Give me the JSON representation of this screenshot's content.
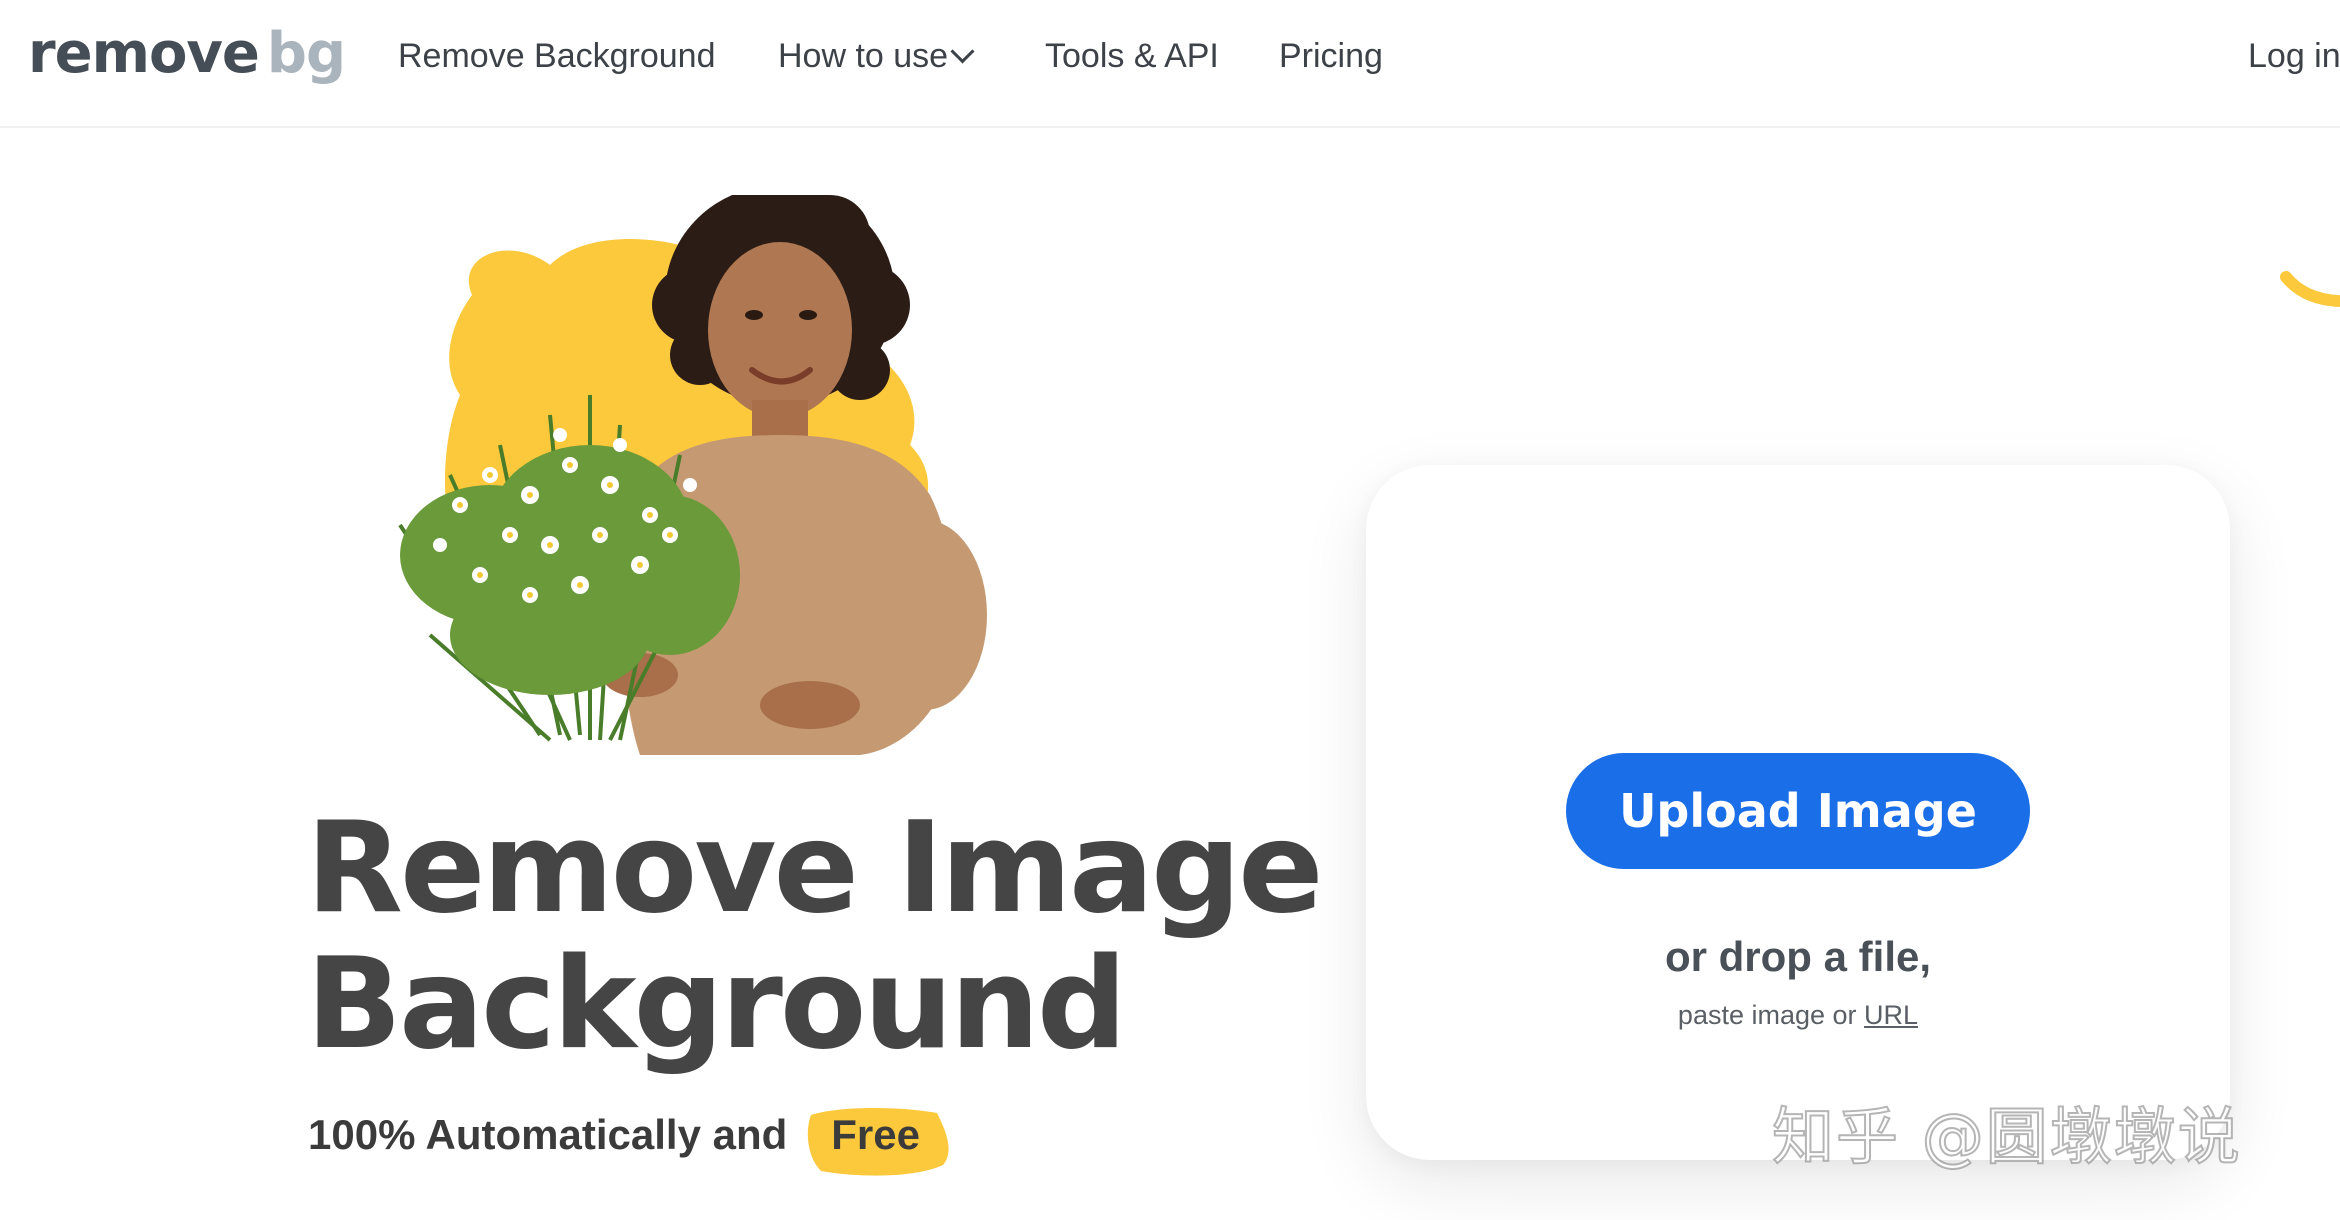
{
  "header": {
    "logo": {
      "part1": "remove",
      "part2": "bg"
    },
    "nav": {
      "remove_background": "Remove Background",
      "how_to_use": "How to use",
      "tools_api": "Tools & API",
      "pricing": "Pricing",
      "login": "Log in"
    }
  },
  "hero": {
    "headline_line1": "Remove Image",
    "headline_line2": "Background",
    "subline_prefix": "100% Automatically and",
    "subline_highlight": "Free"
  },
  "upload": {
    "button_label": "Upload Image",
    "drop_text": "or drop a file,",
    "paste_prefix": "paste image or",
    "url_link": "URL"
  },
  "watermark": "知乎 @圆墩墩说",
  "colors": {
    "brand_blue": "#1a6fe8",
    "accent_yellow": "#fcc93c",
    "text_dark": "#454545",
    "logo_gray": "#454e56",
    "logo_light": "#aab4bc"
  },
  "icons": {
    "how_to_use_dropdown": "chevron-down-icon"
  }
}
